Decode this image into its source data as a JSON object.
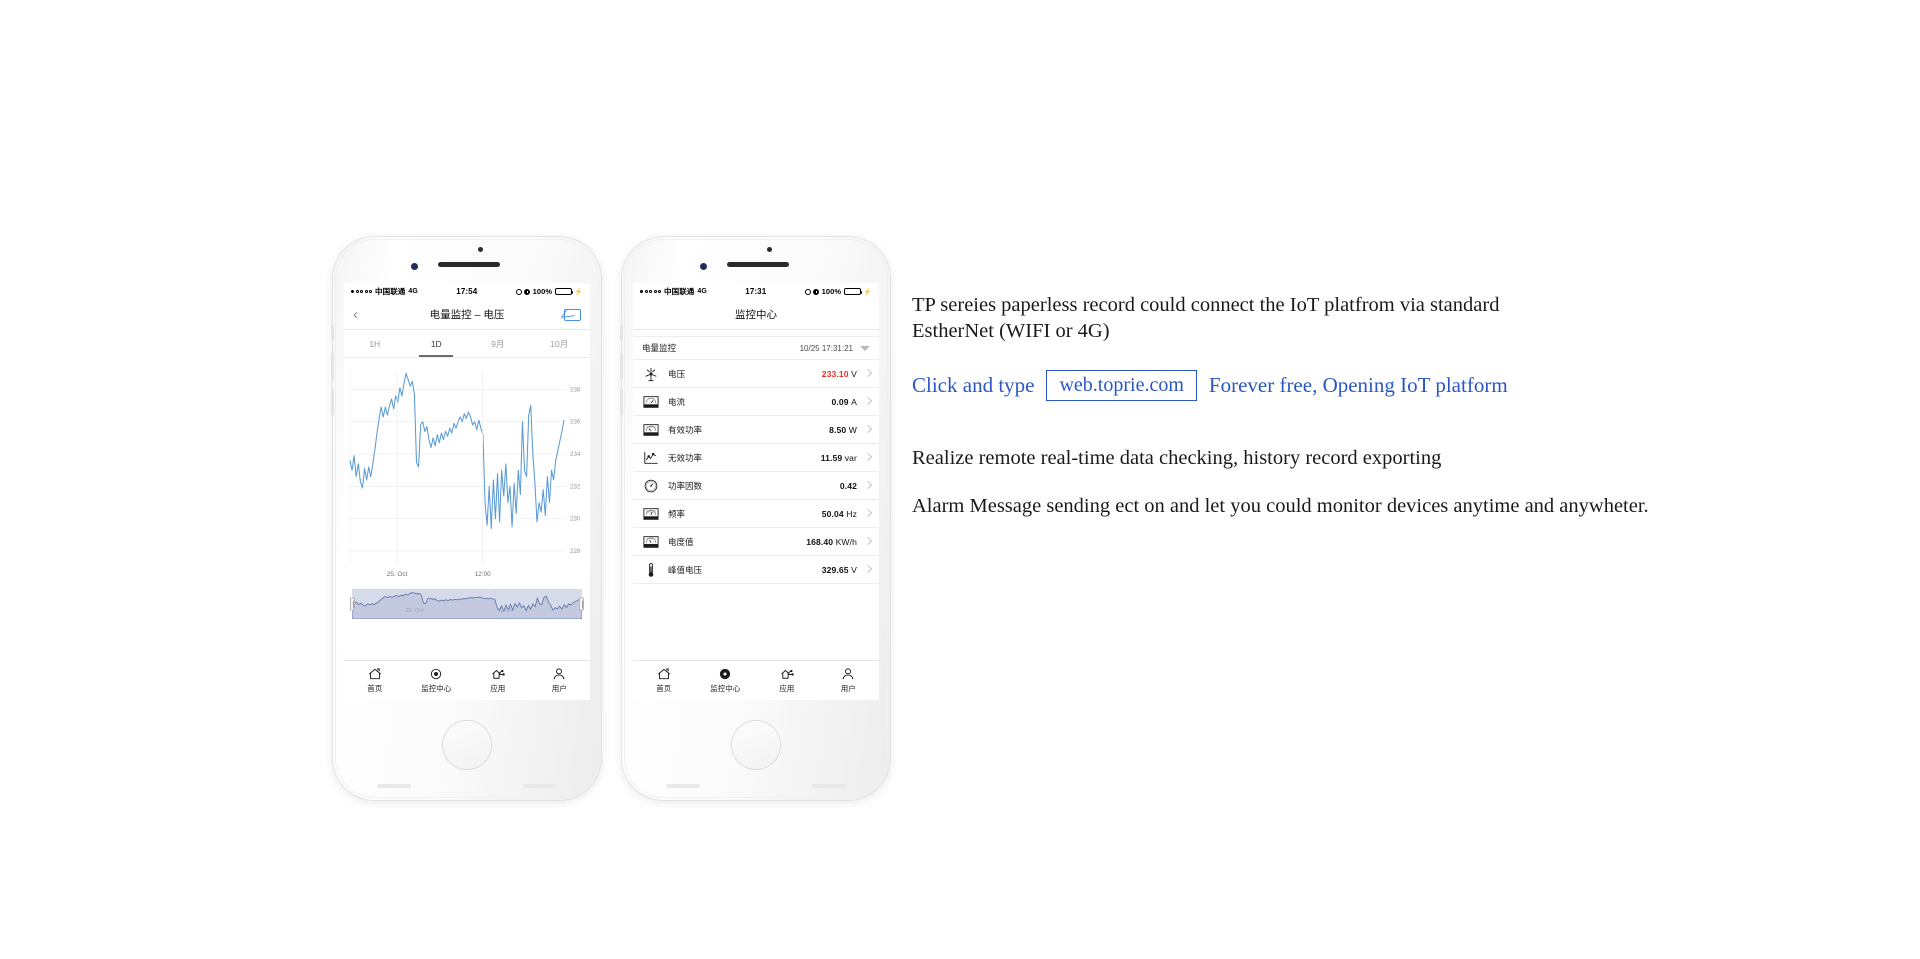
{
  "phone1": {
    "status": {
      "carrier": "中国联通",
      "network": "4G",
      "time": "17:54",
      "battery_percent": "100%",
      "signal_dots": 5,
      "signal_filled": 1
    },
    "nav": {
      "back_icon": "chevron-left-icon",
      "title": "电量监控 – 电压",
      "mail_icon": "envelope-icon"
    },
    "tabs": [
      {
        "label": "1H",
        "active": false
      },
      {
        "label": "1D",
        "active": true
      },
      {
        "label": "9月",
        "active": false
      },
      {
        "label": "10月",
        "active": false
      }
    ],
    "tabbar": [
      {
        "label": "首页",
        "icon": "home-icon",
        "active": false
      },
      {
        "label": "监控中心",
        "icon": "monitor-dot-icon",
        "active": false
      },
      {
        "label": "应用",
        "icon": "apps-icon",
        "active": false
      },
      {
        "label": "用户",
        "icon": "user-icon",
        "active": false
      }
    ]
  },
  "phone2": {
    "status": {
      "carrier": "中国联通",
      "network": "4G",
      "time": "17:31",
      "battery_percent": "100%",
      "signal_dots": 5,
      "signal_filled": 1
    },
    "nav": {
      "title": "监控中心"
    },
    "list_header": {
      "title": "电量监控",
      "timestamp": "10/25 17:31:21",
      "caret_icon": "caret-down-icon"
    },
    "rows": [
      {
        "label": "电压",
        "value": "233.10",
        "unit": "V",
        "icon": "wind-turbine-icon",
        "alert": true
      },
      {
        "label": "电流",
        "value": "0.09",
        "unit": "A",
        "icon": "ammeter-icon",
        "alert": false
      },
      {
        "label": "有效功率",
        "value": "8.50",
        "unit": "W",
        "icon": "wattmeter-icon",
        "alert": false
      },
      {
        "label": "无效功率",
        "value": "11.59",
        "unit": "var",
        "icon": "line-chart-icon",
        "alert": false
      },
      {
        "label": "功率因数",
        "value": "0.42",
        "unit": "",
        "icon": "gauge-icon",
        "alert": false
      },
      {
        "label": "频率",
        "value": "50.04",
        "unit": "Hz",
        "icon": "frequency-meter-icon",
        "alert": false
      },
      {
        "label": "电度值",
        "value": "168.40",
        "unit": "KW/h",
        "icon": "energy-meter-icon",
        "alert": false
      },
      {
        "label": "峰值电压",
        "value": "329.65",
        "unit": "V",
        "icon": "thermometer-icon",
        "alert": false
      }
    ],
    "tabbar": [
      {
        "label": "首页",
        "icon": "home-icon",
        "active": false
      },
      {
        "label": "监控中心",
        "icon": "monitor-dot-icon",
        "active": true
      },
      {
        "label": "应用",
        "icon": "apps-icon",
        "active": false
      },
      {
        "label": "用户",
        "icon": "user-icon",
        "active": false
      }
    ]
  },
  "copy": {
    "para1_line1": "TP sereies paperless record could connect the  IoT platfrom via standard",
    "para1_line2": "EstherNet (WIFI or 4G)",
    "cta_prefix": "Click and type",
    "cta_url": "web.toprie.com",
    "cta_suffix": "Forever free, Opening IoT platform",
    "para2": "Realize remote real-time data checking, history record exporting",
    "para3": "Alarm  Message sending  ect on and let you could monitor devices anytime and anywheter."
  },
  "colors": {
    "accent_blue": "#2b57c4",
    "chart_line": "#5b9bd5",
    "alert_red": "#e8302a",
    "battery_green": "#3ad43a",
    "navigator_bg": "#d6dbea"
  },
  "chart_data": {
    "type": "line",
    "title": "电量监控 – 电压",
    "xlabel": "",
    "ylabel": "",
    "unit": "V",
    "ylim": [
      227.2,
      239.2
    ],
    "yticks": [
      238,
      236,
      234,
      232,
      230,
      228
    ],
    "xtick_labels": [
      "25. Oct",
      "12:00"
    ],
    "xtick_positions": [
      0.22,
      0.62
    ],
    "grid": true,
    "legend": null,
    "series": [
      {
        "name": "电压",
        "values": [
          233.6,
          233.0,
          233.9,
          232.6,
          233.4,
          232.3,
          231.9,
          233.1,
          232.4,
          233.2,
          232.6,
          233.4,
          234.3,
          235.3,
          236.2,
          236.9,
          236.3,
          236.9,
          236.4,
          237.0,
          237.4,
          236.8,
          237.6,
          237.2,
          238.1,
          237.6,
          238.4,
          239.0,
          238.6,
          238.2,
          238.5,
          237.7,
          233.5,
          233.2,
          235.8,
          236.0,
          235.4,
          235.7,
          234.9,
          234.4,
          235.0,
          234.5,
          235.2,
          234.7,
          235.3,
          234.9,
          235.4,
          235.1,
          235.6,
          235.3,
          235.9,
          235.6,
          236.0,
          236.3,
          236.0,
          236.5,
          236.2,
          236.6,
          236.3,
          235.8,
          236.0,
          235.5,
          236.1,
          235.6,
          235.2,
          231.0,
          229.6,
          232.0,
          229.4,
          232.4,
          230.0,
          232.8,
          229.8,
          233.0,
          231.4,
          233.4,
          231.0,
          232.0,
          229.5,
          232.2,
          230.3,
          233.0,
          231.5,
          236.0,
          233.0,
          232.6,
          236.4,
          237.0,
          234.0,
          232.2,
          229.8,
          231.0,
          230.4,
          231.8,
          230.2,
          232.6,
          231.0,
          233.0,
          232.4,
          233.6,
          234.2,
          234.8,
          235.4,
          236.1
        ]
      }
    ],
    "navigator": {
      "enabled": true,
      "selected_range": [
        0,
        1
      ],
      "xtick_labels": [
        "25. Oct",
        "12:00"
      ]
    }
  }
}
